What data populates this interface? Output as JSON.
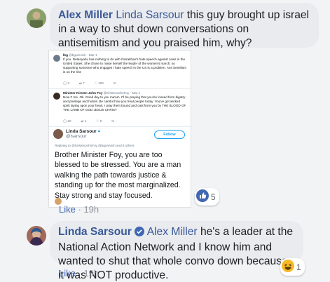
{
  "comment1": {
    "author": "Alex Miller",
    "mention": "Linda Sarsour",
    "text": " this guy brought up israel in a way to shut down conversations on antisemitism and you praised him, why?",
    "meta": {
      "like": "Like",
      "dot": "·",
      "time": "19h"
    },
    "reaction_count": "5",
    "reaction_icon": "like-thumb-icon"
  },
  "embedded": {
    "tweet1": {
      "name": "lbg",
      "handle": "@bgurevich · Mar 1",
      "text": "If you. Netanyahu has nothing to do with Farrakhan's hate speech against Jews in the United States. She chose to make herself the leader of the women's march, so supporting someone who engages I hate speech in the US is a problem. Anti Semitism is on the rise",
      "actions": [
        "3",
        "7",
        "109",
        ""
      ]
    },
    "tweet2": {
      "name": "Minister Kirsten John Foy",
      "handle": "@KirstenJohnFoy · Mar 1",
      "text": "Now F me. Ok. Good day to you ma'am. I'll be praying that you be loosed from bigotry and privilege and hubris. Be careful how you treat people today. You've got wicked spirit laying upon your heart. I pray them bound and cast from you by THE BLOOD OF THE LAMB OF GOD JESUS CHRIST",
      "actions": [
        "20",
        "1",
        "6",
        ""
      ]
    },
    "reply": {
      "name": "Linda Sarsour",
      "handle": "@lsarsour",
      "follow": "Follow",
      "replying": "Replying to @KirstenJohnFoy @bgurevich and 8 others",
      "text": "Brother Minister Foy, you are too blessed to be stressed. You are a man walking the path towards justice & standing up for the most marginalized. Stay strong and stay focused."
    }
  },
  "comment2": {
    "author": "Linda Sarsour",
    "mention": "Alex Miller",
    "text": " he's a leader at the National Action Network and I know him and wanted to shut that whole convo down because it was NOT productive.",
    "meta": {
      "like": "Like",
      "dot": "·",
      "time": "19h"
    },
    "reaction_count": "1",
    "reaction_icon": "haha-emoji-icon"
  },
  "colors": {
    "accent": "#385898",
    "like_blue": "#4267b2",
    "bubble": "#e9ebee",
    "verified": "#4267b2",
    "haha": "#f7b928"
  }
}
